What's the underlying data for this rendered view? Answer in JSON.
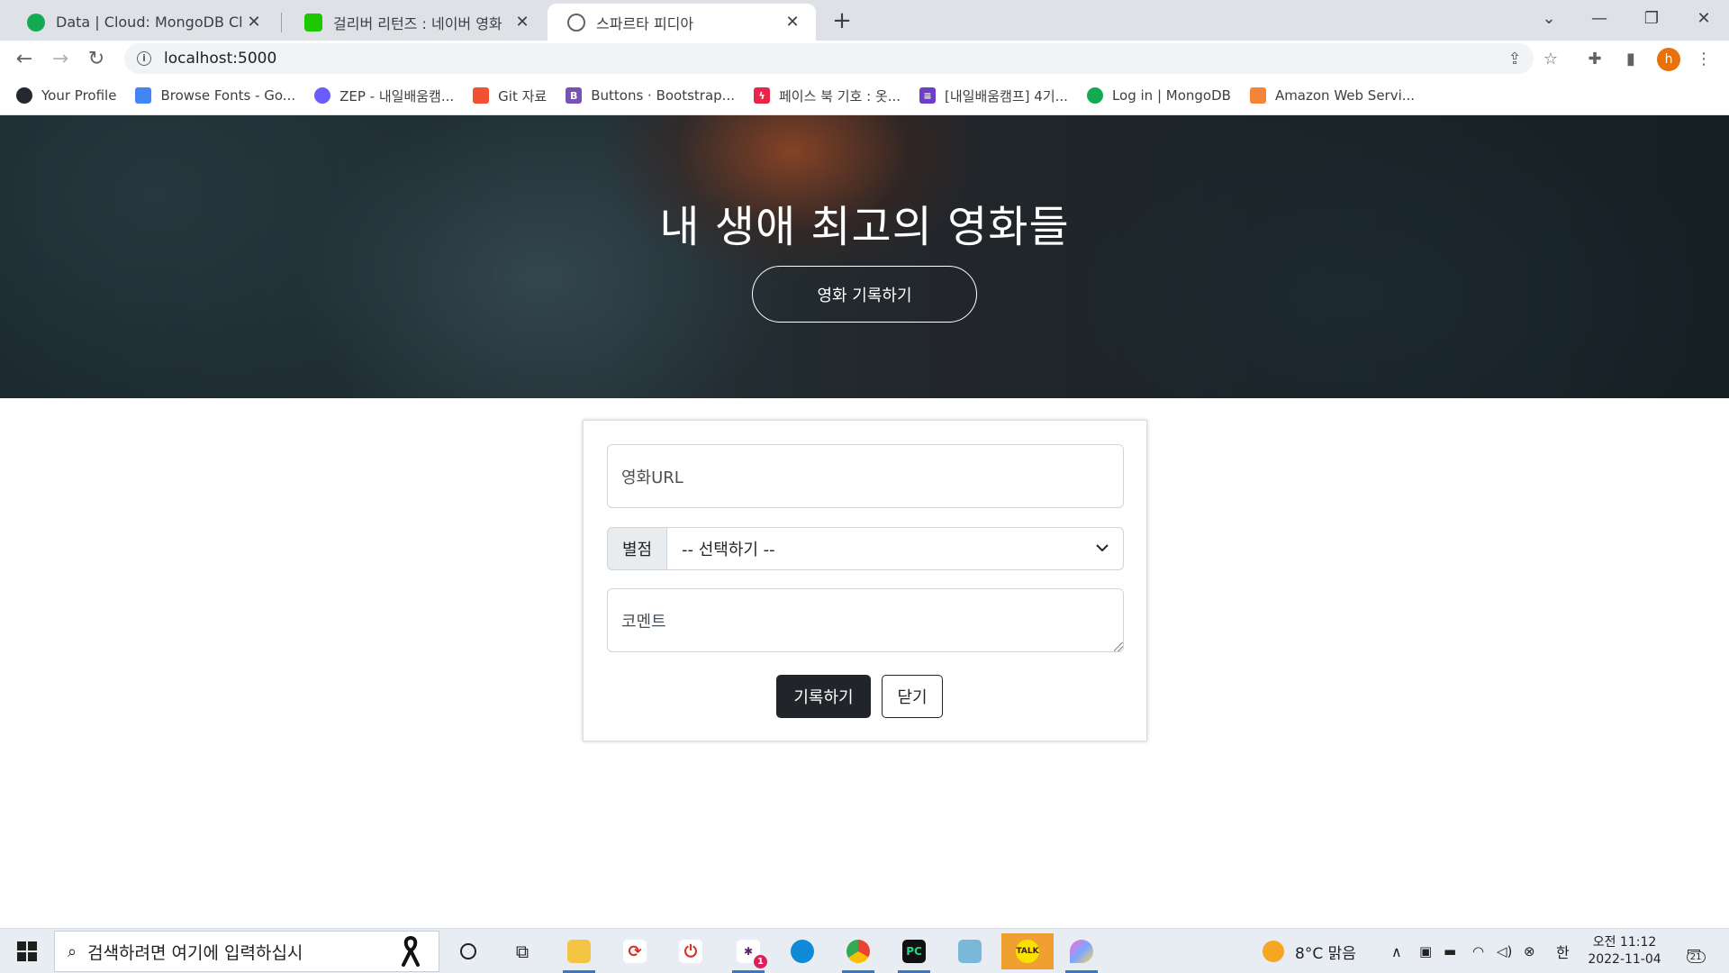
{
  "browser": {
    "tabs": [
      {
        "title": "Data | Cloud: MongoDB Cloud",
        "favicon_color": "#13aa52",
        "active": false
      },
      {
        "title": "걸리버 리턴즈 : 네이버 영화",
        "favicon_color": "#1ec800",
        "active": false
      },
      {
        "title": "스파르타 피디아",
        "favicon_color": "#5f6368",
        "active": true
      }
    ],
    "url": "localhost:5000",
    "profile_initial": "h"
  },
  "bookmarks": [
    {
      "label": "Your Profile",
      "icon": "github-icon",
      "color": "#24292f"
    },
    {
      "label": "Browse Fonts - Go...",
      "icon": "google-fonts-icon",
      "color": "#4285f4"
    },
    {
      "label": "ZEP - 내일배움캠...",
      "icon": "zep-icon",
      "color": "#6a5cff"
    },
    {
      "label": "Git 자료",
      "icon": "git-icon",
      "color": "#f05133"
    },
    {
      "label": "Buttons · Bootstrap...",
      "icon": "bootstrap-icon",
      "color": "#7952b3"
    },
    {
      "label": "페이스 북 기호 : 옷...",
      "icon": "lightning-icon",
      "color": "#e8264a"
    },
    {
      "label": "[내일배움캠프] 4기...",
      "icon": "list-icon",
      "color": "#6e3ec7"
    },
    {
      "label": "Log in | MongoDB",
      "icon": "mongodb-icon",
      "color": "#13aa52"
    },
    {
      "label": "Amazon Web Servi...",
      "icon": "aws-icon",
      "color": "#f58536"
    }
  ],
  "page": {
    "hero_title": "내 생애 최고의 영화들",
    "hero_button": "영화 기록하기",
    "form": {
      "url_placeholder": "영화URL",
      "star_label": "별점",
      "star_selected": "-- 선택하기 --",
      "comment_placeholder": "코멘트",
      "save_button": "기록하기",
      "close_button": "닫기"
    }
  },
  "taskbar": {
    "search_placeholder": "검색하려면 여기에 입력하십시",
    "weather": "8°C  맑음",
    "ime": "한",
    "time": "오전 11:12",
    "date": "2022-11-04",
    "notifications": "21",
    "slack_badge": "1"
  }
}
